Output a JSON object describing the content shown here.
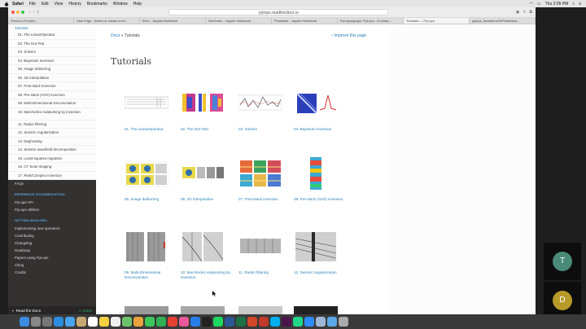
{
  "menubar": {
    "app": "Safari",
    "items": [
      "File",
      "Edit",
      "View",
      "History",
      "Bookmarks",
      "Window",
      "Help"
    ],
    "clock": "Thu 2:05 PM"
  },
  "browser": {
    "url": "pylops.readthedocs.io",
    "tabs": [
      "Fixed-to-Free(fs)...",
      "How Fdge - Select or create a ext...",
      "Eero - Jupyter Notebook",
      "HorGoms - Jupyter Notebook",
      "Poststack - Jupyter Notebook",
      "PyLops/pylops: PyLops - A Linear...",
      "Tutorials — PyLops",
      "pylops_transform/20/Poststack..."
    ]
  },
  "sidebar": {
    "top_link": "Tutorials",
    "items": [
      "01. The LinearOperator",
      "02. The Dot-Test",
      "03. Solvers",
      "04. Bayesian Inversion",
      "05. Image deblurring",
      "06. 2D Interpolation",
      "07. Post-stack inversion",
      "08. Pre-stack (AVO) inversion",
      "09. Multi-Dimensional Deconvolution",
      "10. Marchenko redatuming by inversion",
      "11. Radon filtering",
      "12. Seismic regularization",
      "13. Deghosting",
      "14. Seismic wavefield decomposition",
      "15. Least-squares migration",
      "16. CT Scan Imaging",
      "17. Real/Complex Inversion"
    ],
    "faq": "FAQs",
    "ref_caption": "REFERENCE DOCUMENTATION:",
    "ref_items": [
      "PyLops API",
      "PyLops Utilities"
    ],
    "inv_caption": "GETTING INVOLVED:",
    "inv_items": [
      "Implementing new operators",
      "Contributing",
      "Changelog",
      "Roadmap",
      "Papers using PyLops",
      "Citing",
      "Credits"
    ],
    "footer_label": "Read the Docs",
    "footer_version": "v: latest"
  },
  "content": {
    "breadcrumb_home": "Docs",
    "breadcrumb_sep": "»",
    "breadcrumb_current": "Tutorials",
    "improve": "Improve this page",
    "title": "Tutorials",
    "thumbs": [
      "01. The LinearOperator",
      "02. The Dot-Test",
      "03. Solvers",
      "04. Bayesian Inversion",
      "05. Image deblurring",
      "06. 2D Interpolation",
      "07. Post-stack inversion",
      "08. Pre-stack (AVO) inversion",
      "09. Multi-Dimensional Deconvolution",
      "10. Marchenko redatuming by inversion",
      "11. Radon filtering",
      "12. Seismic regularization"
    ]
  },
  "meeting": {
    "participants": [
      "T",
      "D"
    ]
  }
}
